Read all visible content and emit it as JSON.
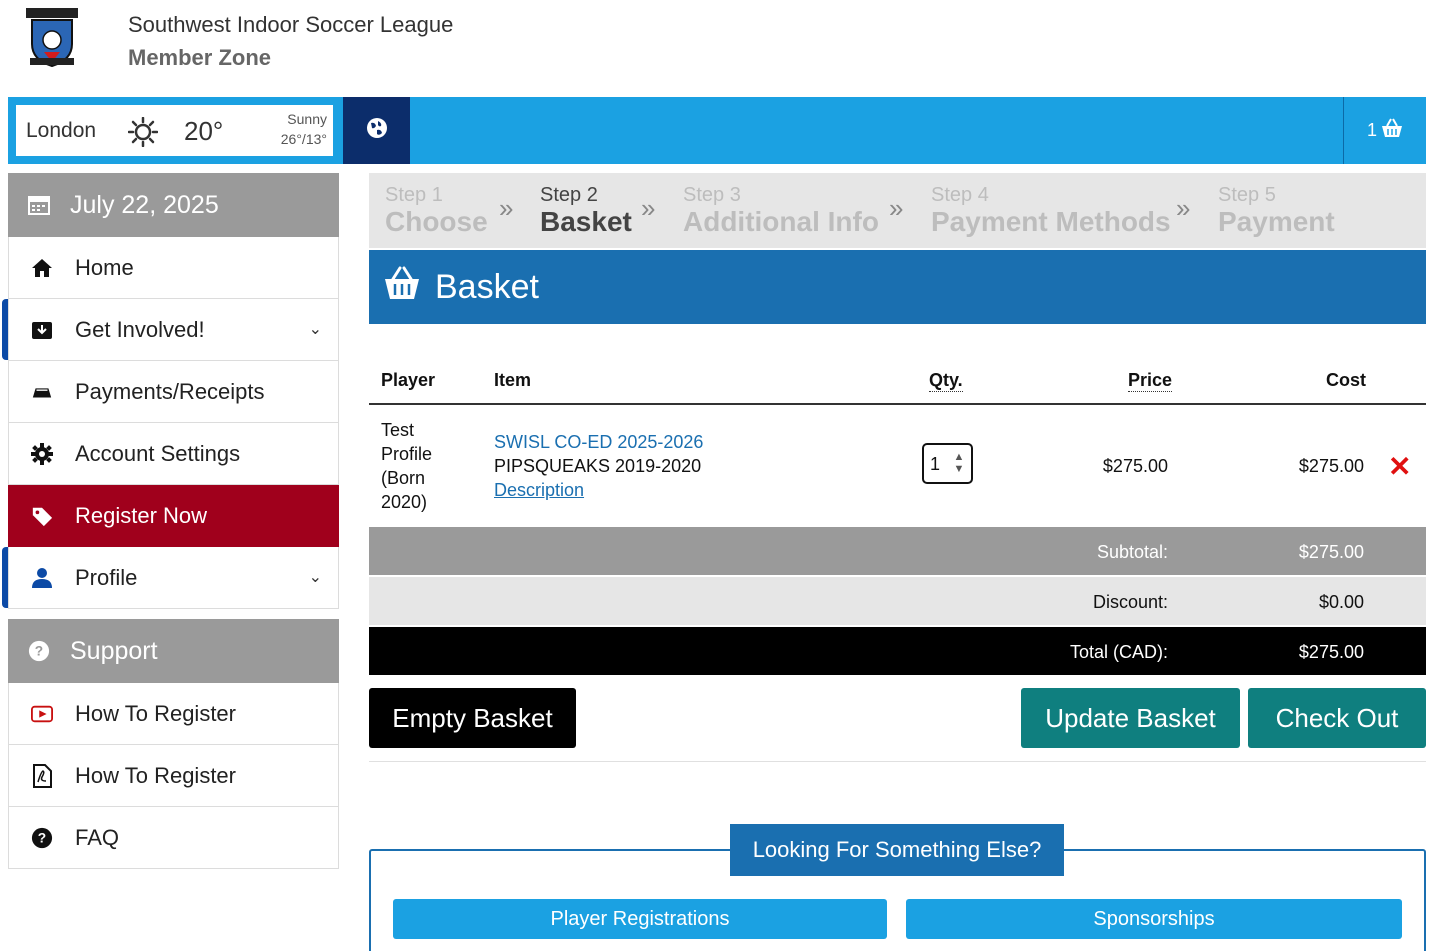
{
  "header": {
    "title": "Southwest Indoor Soccer League",
    "subtitle": "Member Zone",
    "logo_icon": "league-crest-logo"
  },
  "weather": {
    "city": "London",
    "temp": "20°",
    "condition": "Sunny",
    "range": "26°/13°",
    "icon": "sun-icon"
  },
  "topbar": {
    "cart_count": "1",
    "globe_icon": "globe-icon",
    "cart_icon": "basket-icon"
  },
  "sidebar": {
    "date": "July 22, 2025",
    "items": [
      {
        "label": "Home",
        "icon": "home-icon"
      },
      {
        "label": "Get Involved!",
        "icon": "inbox-icon"
      },
      {
        "label": "Payments/Receipts",
        "icon": "money-icon"
      },
      {
        "label": "Account Settings",
        "icon": "gear-icon"
      },
      {
        "label": "Register Now",
        "icon": "tag-icon"
      },
      {
        "label": "Profile",
        "icon": "user-icon"
      }
    ],
    "support_title": "Support",
    "support_items": [
      {
        "label": "How To Register",
        "icon": "video-icon"
      },
      {
        "label": "How To Register",
        "icon": "pdf-icon"
      },
      {
        "label": "FAQ",
        "icon": "question-icon"
      }
    ]
  },
  "steps": [
    {
      "num": "Step 1",
      "name": "Choose"
    },
    {
      "num": "Step 2",
      "name": "Basket"
    },
    {
      "num": "Step 3",
      "name": "Additional Info"
    },
    {
      "num": "Step 4",
      "name": "Payment Methods"
    },
    {
      "num": "Step 5",
      "name": "Payment"
    }
  ],
  "basket": {
    "title": "Basket",
    "columns": {
      "player": "Player",
      "item": "Item",
      "qty": "Qty.",
      "price": "Price",
      "cost": "Cost"
    },
    "row": {
      "player": "Test Profile (Born 2020)",
      "item_line1": "SWISL CO-ED 2025-2026",
      "item_line2": "PIPSQUEAKS 2019-2020",
      "item_link": "Description",
      "qty": "1",
      "price": "$275.00",
      "cost": "$275.00"
    },
    "subtotal_label": "Subtotal:",
    "subtotal": "$275.00",
    "discount_label": "Discount:",
    "discount": "$0.00",
    "total_label": "Total (CAD):",
    "total": "$275.00"
  },
  "buttons": {
    "empty": "Empty Basket",
    "update": "Update Basket",
    "checkout": "Check Out"
  },
  "looking": {
    "title": "Looking For Something Else?",
    "player": "Player Registrations",
    "sponsorships": "Sponsorships"
  },
  "colors": {
    "topbar": "#1ba1e2",
    "navy": "#0c2d6b",
    "basket_header": "#1a6fb0",
    "register_active": "#a0001c",
    "teal_button": "#0f7f7f"
  }
}
